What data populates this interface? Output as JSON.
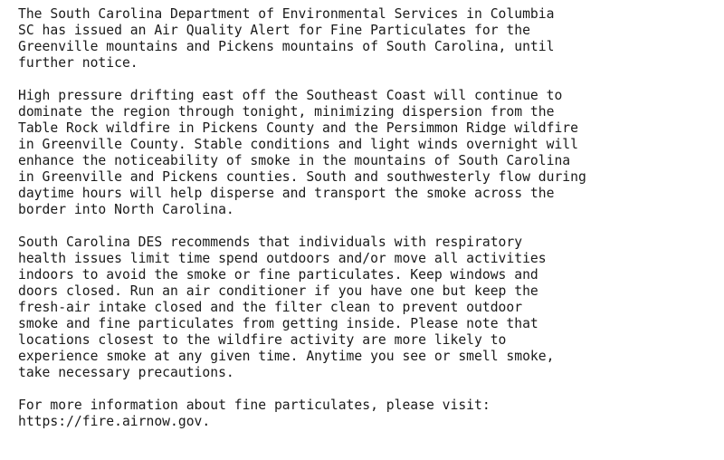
{
  "document": {
    "paragraphs": [
      "The South Carolina Department of Environmental Services in Columbia\nSC has issued an Air Quality Alert for Fine Particulates for the\nGreenville mountains and Pickens mountains of South Carolina, until\nfurther notice.",
      "High pressure drifting east off the Southeast Coast will continue to\ndominate the region through tonight, minimizing dispersion from the\nTable Rock wildfire in Pickens County and the Persimmon Ridge wildfire\nin Greenville County. Stable conditions and light winds overnight will\nenhance the noticeability of smoke in the mountains of South Carolina\nin Greenville and Pickens counties. South and southwesterly flow during\ndaytime hours will help disperse and transport the smoke across the\nborder into North Carolina.",
      "South Carolina DES recommends that individuals with respiratory\nhealth issues limit time spend outdoors and/or move all activities\nindoors to avoid the smoke or fine particulates. Keep windows and\ndoors closed. Run an air conditioner if you have one but keep the\nfresh-air intake closed and the filter clean to prevent outdoor\nsmoke and fine particulates from getting inside. Please note that\nlocations closest to the wildfire activity are more likely to\nexperience smoke at any given time. Anytime you see or smell smoke,\ntake necessary precautions.",
      "For more information about fine particulates, please visit:\nhttps://fire.airnow.gov."
    ]
  }
}
